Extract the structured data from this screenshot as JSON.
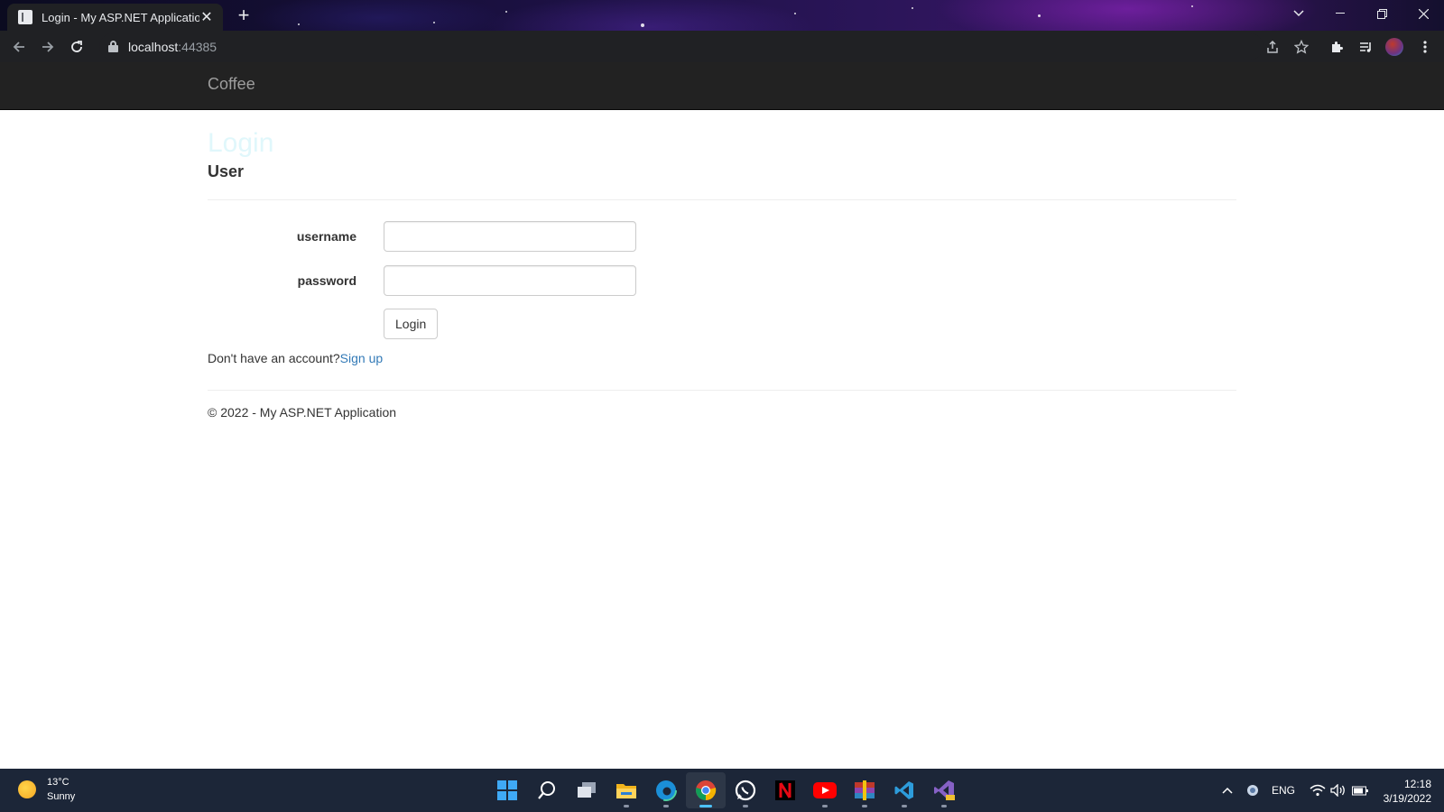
{
  "browser": {
    "tab_title": "Login - My ASP.NET Application",
    "new_tab_symbol": "+",
    "close_symbol": "✕",
    "url_host": "localhost",
    "url_port": ":44385"
  },
  "navbar": {
    "brand": "Coffee"
  },
  "page": {
    "title": "Login",
    "subtitle": "User"
  },
  "form": {
    "username_label": "username",
    "username_value": "",
    "password_label": "password",
    "password_value": "",
    "login_button": "Login"
  },
  "signup": {
    "prompt": "Don't have an account?",
    "link": "Sign up"
  },
  "footer": {
    "text": "© 2022 - My ASP.NET Application"
  },
  "taskbar": {
    "weather_temp": "13°C",
    "weather_desc": "Sunny",
    "language": "ENG",
    "time": "12:18",
    "date": "3/19/2022",
    "apps": [
      "start-icon",
      "search-icon",
      "task-view-icon",
      "file-explorer-icon",
      "edge-icon",
      "chrome-icon",
      "whatsapp-icon",
      "netflix-icon",
      "youtube-icon",
      "winrar-icon",
      "vscode-icon",
      "visual-studio-icon"
    ]
  },
  "colors": {
    "navbar_bg": "#222222",
    "brand": "#9d9d9d",
    "link": "#337ab7",
    "title": "#e0f7fb",
    "taskbar_bg": "#1c2638"
  }
}
